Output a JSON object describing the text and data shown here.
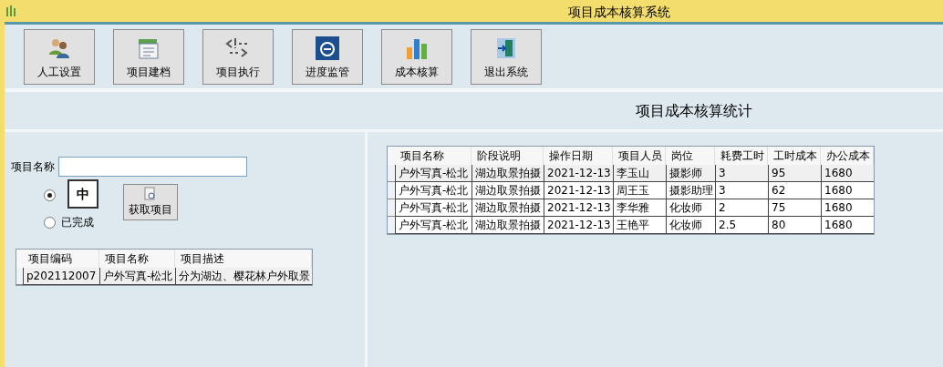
{
  "window": {
    "title": "项目成本核算系统"
  },
  "toolbar": [
    {
      "label": "人工设置",
      "kind": "people"
    },
    {
      "label": "项目建档",
      "kind": "document"
    },
    {
      "label": "项目执行",
      "kind": "code"
    },
    {
      "label": "进度监管",
      "kind": "e"
    },
    {
      "label": "成本核算",
      "kind": "chart"
    },
    {
      "label": "退出系统",
      "kind": "exit"
    }
  ],
  "header": {
    "title": "项目成本核算统计"
  },
  "left": {
    "name_label": "项目名称",
    "ime_indicator": "中",
    "radios": [
      {
        "selected": true
      },
      {
        "label": "已完成",
        "selected": false
      }
    ],
    "fetch_button": "获取项目",
    "table": {
      "columns": [
        "项目编码",
        "项目名称",
        "项目描述"
      ],
      "rows": [
        [
          "p202112007",
          "户外写真-松北",
          "分为湖边、樱花林户外取景"
        ]
      ]
    }
  },
  "right": {
    "table": {
      "columns": [
        "项目名称",
        "阶段说明",
        "操作日期",
        "项目人员",
        "岗位",
        "耗费工时",
        "工时成本",
        "办公成本"
      ],
      "rows": [
        [
          "户外写真-松北",
          "湖边取景拍摄",
          "2021-12-13",
          "李玉山",
          "摄影师",
          "3",
          "95",
          "1680"
        ],
        [
          "户外写真-松北",
          "湖边取景拍摄",
          "2021-12-13",
          "周王玉",
          "摄影助理",
          "3",
          "62",
          "1680"
        ],
        [
          "户外写真-松北",
          "湖边取景拍摄",
          "2021-12-13",
          "李华雅",
          "化妆师",
          "2",
          "75",
          "1680"
        ],
        [
          "户外写真-松北",
          "湖边取景拍摄",
          "2021-12-13",
          "王艳平",
          "化妆师",
          "2.5",
          "80",
          "1680"
        ]
      ]
    }
  }
}
